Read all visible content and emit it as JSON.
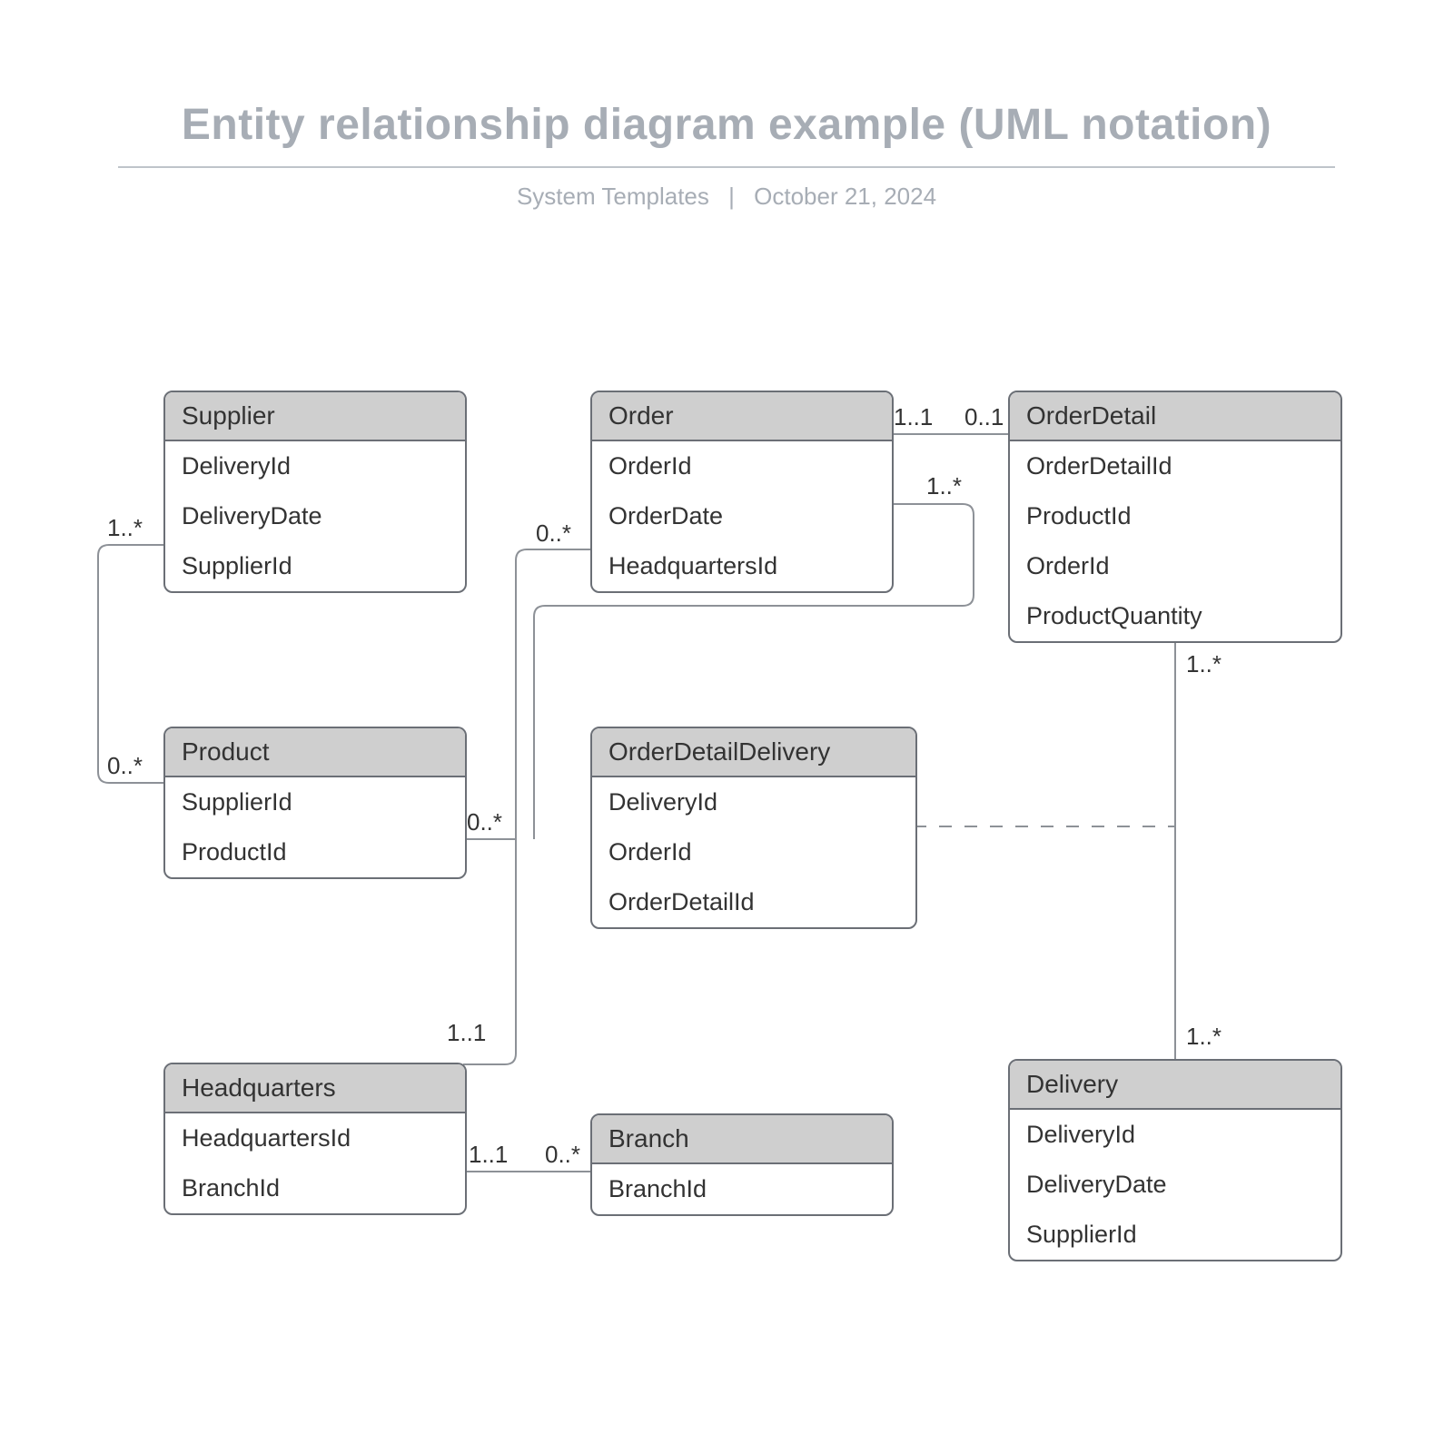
{
  "header": {
    "title": "Entity relationship diagram example (UML notation)",
    "sub_left": "System Templates",
    "sub_sep": "|",
    "sub_right": "October 21, 2024"
  },
  "entities": {
    "supplier": {
      "name": "Supplier",
      "attrs": [
        "DeliveryId",
        "DeliveryDate",
        "SupplierId"
      ]
    },
    "order": {
      "name": "Order",
      "attrs": [
        "OrderId",
        "OrderDate",
        "HeadquartersId"
      ]
    },
    "orderdetail": {
      "name": "OrderDetail",
      "attrs": [
        "OrderDetailId",
        "ProductId",
        "OrderId",
        "ProductQuantity"
      ]
    },
    "product": {
      "name": "Product",
      "attrs": [
        "SupplierId",
        "ProductId"
      ]
    },
    "odd": {
      "name": "OrderDetailDelivery",
      "attrs": [
        "DeliveryId",
        "OrderId",
        "OrderDetailId"
      ]
    },
    "hq": {
      "name": "Headquarters",
      "attrs": [
        "HeadquartersId",
        "BranchId"
      ]
    },
    "branch": {
      "name": "Branch",
      "attrs": [
        "BranchId"
      ]
    },
    "delivery": {
      "name": "Delivery",
      "attrs": [
        "DeliveryId",
        "DeliveryDate",
        "SupplierId"
      ]
    }
  },
  "multiplicities": {
    "supplier_to_product_top": "1..*",
    "supplier_to_product_bot": "0..*",
    "order_to_product": "0..*",
    "product_to_order": "0..*",
    "order_to_orderdetail_left": "1..1",
    "order_to_orderdetail_right": "0..1",
    "orderdetail_1star": "1..*",
    "orderdetail_to_delivery_top": "1..*",
    "orderdetail_to_delivery_bot": "1..*",
    "hq_to_order": "1..1",
    "hq_to_branch_left": "1..1",
    "hq_to_branch_right": "0..*"
  }
}
